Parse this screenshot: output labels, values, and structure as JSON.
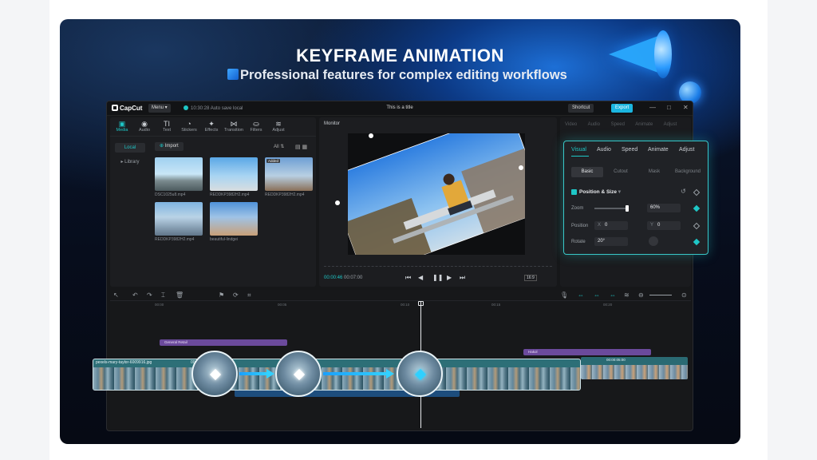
{
  "hero": {
    "title": "KEYFRAME ANIMATION",
    "subtitle": "Professional features for complex editing workflows"
  },
  "app": {
    "logo": "CapCut",
    "menu_label": "Menu",
    "autosave": "10:30:28 Auto save local",
    "window_title": "This is a title",
    "shortcut_label": "Shortcut",
    "export_label": "Export"
  },
  "tool_tabs": [
    {
      "icon": "▣",
      "label": "Media"
    },
    {
      "icon": "◉",
      "label": "Audio"
    },
    {
      "icon": "TI",
      "label": "Text"
    },
    {
      "icon": "◔",
      "label": "Stickers"
    },
    {
      "icon": "✦",
      "label": "Effects"
    },
    {
      "icon": "⋈",
      "label": "Transition"
    },
    {
      "icon": "⛀",
      "label": "Filters"
    },
    {
      "icon": "≋",
      "label": "Adjust"
    }
  ],
  "media": {
    "side_local": "Local",
    "side_library": "Library",
    "import_label": "Import",
    "filter_all": "All",
    "items": [
      {
        "caption": "DSC1025u8.mp4",
        "added": ""
      },
      {
        "caption": "REDDKP3982H2.mp4",
        "added": ""
      },
      {
        "caption": "REDDKP3982H2.mp4",
        "added": "Added"
      },
      {
        "caption": "REDDKP3982H2.mp4",
        "added": ""
      },
      {
        "caption": "beautiful-lindgei",
        "added": ""
      }
    ]
  },
  "monitor": {
    "label": "Monitor",
    "time_current": "00:00:46",
    "time_total": "00:07:00",
    "ratio": "16:9"
  },
  "inspector_bg_tabs": "Video Audio Speed Animate Adjust",
  "inspector": {
    "tabs": [
      "Visual",
      "Audio",
      "Speed",
      "Animate",
      "Adjust"
    ],
    "subtabs": [
      "Basic",
      "Cutout",
      "Mask",
      "Background"
    ],
    "section": "Position & Size",
    "zoom_label": "Zoom",
    "zoom_value": "60%",
    "position_label": "Position",
    "pos_x_label": "X",
    "pos_x": "0",
    "pos_y_label": "Y",
    "pos_y": "0",
    "rotate_label": "Rotate",
    "rotate_value": "20°",
    "colors": {
      "accent": "#1ec6c6",
      "keyframe": "#2fd0ff"
    }
  },
  "timeline": {
    "ruler": [
      "00:00",
      "00:05",
      "00:10",
      "00:15",
      "00:20"
    ],
    "clip_effect": "General Retail",
    "clip_effect2": "Hakol",
    "main_clip_title": "pexels-mary-taylor-6009916.jpg",
    "main_clip_duration": "00:00:00:4",
    "side_clip_duration": "00:00:05:00"
  }
}
